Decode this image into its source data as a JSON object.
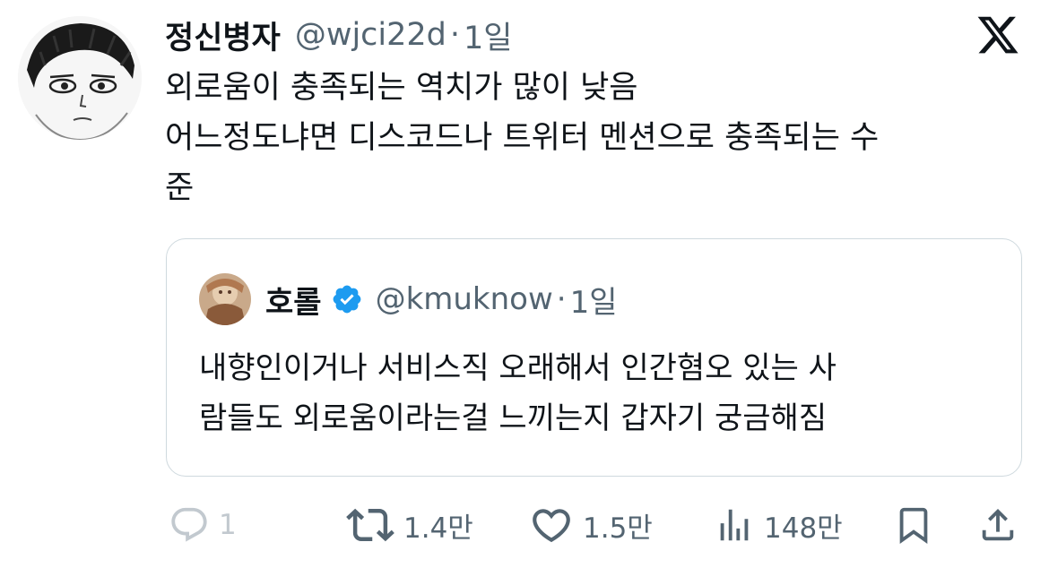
{
  "tweet": {
    "author": {
      "display_name": "정신병자",
      "handle": "@wjci22d",
      "time": "1일"
    },
    "separator": "·",
    "lines": [
      "외로움이 충족되는 역치가 많이 낮음",
      "어느정도냐면 디스코드나 트위터 멘션으로 충족되는 수",
      "준"
    ]
  },
  "quoted": {
    "author": {
      "display_name": "호롤",
      "handle": "@kmuknow",
      "time": "1일"
    },
    "separator": "·",
    "lines": [
      "내향인이거나 서비스직 오래해서 인간혐오 있는 사",
      "람들도 외로움이라는걸 느끼는지 갑자기 궁금해짐"
    ]
  },
  "actions": {
    "reply_count": "1",
    "retweet_count": "1.4만",
    "like_count": "1.5만",
    "view_count": "148만"
  },
  "icons": {
    "logo": "x-logo-icon",
    "verified": "verified-badge-icon",
    "reply": "reply-icon",
    "retweet": "retweet-icon",
    "like": "heart-icon",
    "views": "views-icon",
    "bookmark": "bookmark-icon",
    "share": "share-icon"
  },
  "colors": {
    "text": "#0f1419",
    "secondary": "#536471",
    "verified": "#1d9bf0",
    "border": "#cfd9de"
  }
}
